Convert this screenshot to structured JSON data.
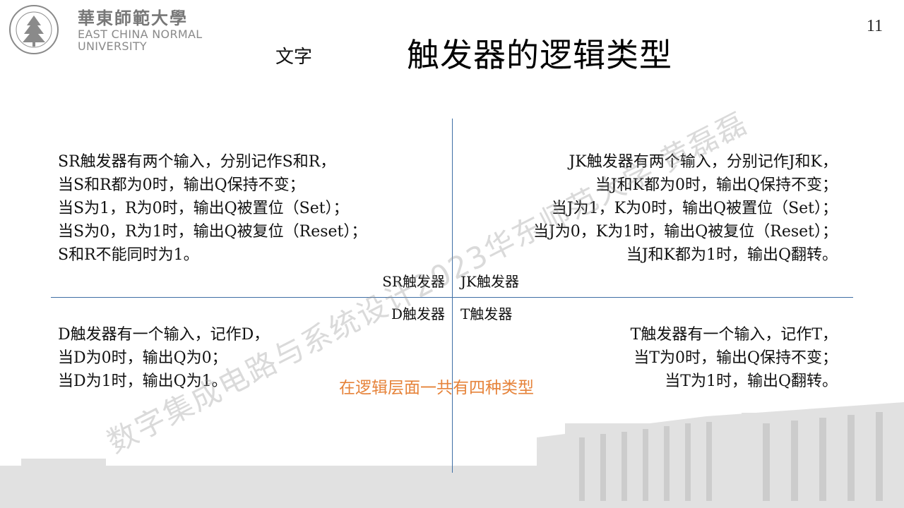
{
  "header": {
    "logo": {
      "cn": "華東師範大學",
      "en_line1": "EAST CHINA NORMAL",
      "en_line2": "UNIVERSITY",
      "seal_icon": "ecnu-seal-icon"
    },
    "page_number": "11"
  },
  "slide": {
    "subtitle": "文字",
    "title": "触发器的逻辑类型"
  },
  "quadrant_labels": {
    "sr": "SR触发器",
    "jk": "JK触发器",
    "d": "D触发器",
    "t": "T触发器"
  },
  "descriptions": {
    "sr": [
      "SR触发器有两个输入，分别记作S和R，",
      "当S和R都为0时，输出Q保持不变；",
      "当S为1，R为0时，输出Q被置位（Set）；",
      "当S为0，R为1时，输出Q被复位（Reset）；",
      "S和R不能同时为1。"
    ],
    "jk": [
      "JK触发器有两个输入，分别记作J和K，",
      "当J和K都为0时，输出Q保持不变；",
      "当J为1，K为0时，输出Q被置位（Set）；",
      "当J为0，K为1时，输出Q被复位（Reset）；",
      "当J和K都为1时，输出Q翻转。"
    ],
    "d": [
      "D触发器有一个输入，记作D，",
      "当D为0时，输出Q为0；",
      "当D为1时，输出Q为1。"
    ],
    "t": [
      "T触发器有一个输入，记作T，",
      "当T为0时，输出Q保持不变；",
      "当T为1时，输出Q翻转。"
    ]
  },
  "summary": "在逻辑层面一共有四种类型",
  "watermark": "数字集成电路与系统设计2023华东师范大学 黄磊磊",
  "colors": {
    "axis": "#3f6fa5",
    "summary": "#e6833a",
    "logo_text": "#777777"
  }
}
